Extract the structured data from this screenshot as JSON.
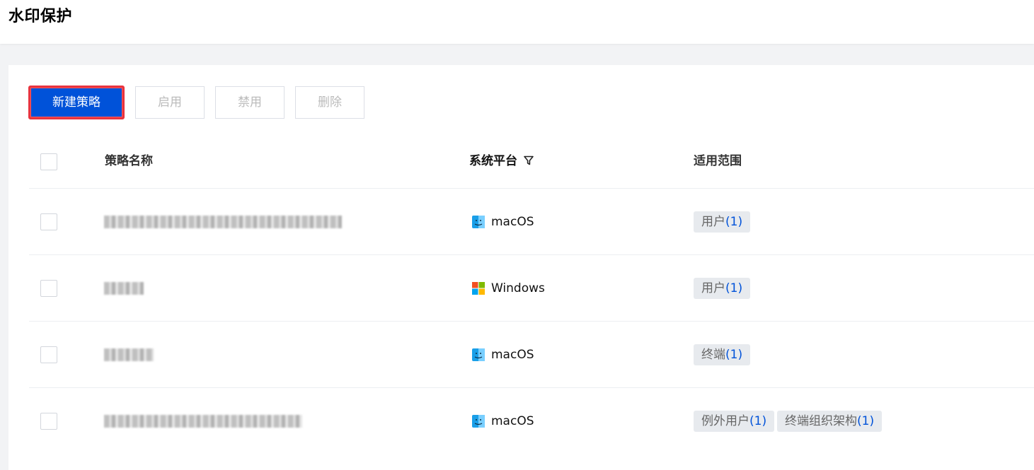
{
  "page": {
    "title": "水印保护"
  },
  "toolbar": {
    "new_label": "新建策略",
    "enable_label": "启用",
    "disable_label": "禁用",
    "delete_label": "删除"
  },
  "table": {
    "headers": {
      "name": "策略名称",
      "platform": "系统平台",
      "scope": "适用范围"
    },
    "rows": [
      {
        "name": "",
        "platform": "macOS",
        "platform_icon": "finder-icon",
        "scopes": [
          {
            "label": "用户",
            "count": "(1)"
          }
        ]
      },
      {
        "name": "",
        "platform": "Windows",
        "platform_icon": "windows-icon",
        "scopes": [
          {
            "label": "用户",
            "count": "(1)"
          }
        ]
      },
      {
        "name": "",
        "platform": "macOS",
        "platform_icon": "finder-icon",
        "scopes": [
          {
            "label": "终端",
            "count": "(1)"
          }
        ]
      },
      {
        "name": "",
        "platform": "macOS",
        "platform_icon": "finder-icon",
        "scopes": [
          {
            "label": "例外用户",
            "count": "(1)"
          },
          {
            "label": "终端组织架构",
            "count": "(1)"
          }
        ]
      }
    ]
  },
  "colors": {
    "primary": "#0052d9",
    "highlight": "#e8343f",
    "tag_bg": "#e7eaee"
  }
}
